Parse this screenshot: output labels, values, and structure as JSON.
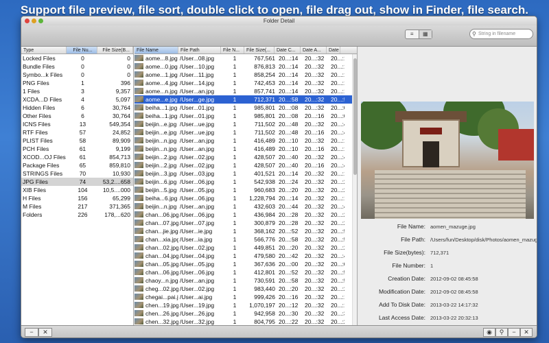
{
  "banner": "Support file preview, file sort, double click to open, file drag out, show in Finder, file search.",
  "window_title": "Folder Detail",
  "search": {
    "placeholder": "String in filename"
  },
  "icons": {
    "list": "list-icon",
    "grid": "grid-icon",
    "search": "magnifier-icon",
    "eye": "eye-icon"
  },
  "type_table": {
    "headers": [
      "Type",
      "File Nu...",
      "File Size(B..."
    ],
    "rows": [
      [
        "Locked Files",
        "0",
        "0"
      ],
      [
        "Bundle Files",
        "0",
        "0"
      ],
      [
        "Symbo...k Files",
        "0",
        "0"
      ],
      [
        "PNG Files",
        "1",
        "396"
      ],
      [
        "1 Files",
        "3",
        "9,357"
      ],
      [
        "XCDA...D Files",
        "4",
        "5,097"
      ],
      [
        "Hidden Files",
        "6",
        "30,764"
      ],
      [
        "Other Files",
        "6",
        "30,764"
      ],
      [
        "ICNS Files",
        "13",
        "549,354"
      ],
      [
        "RTF Files",
        "57",
        "24,852"
      ],
      [
        "PLIST Files",
        "58",
        "89,909"
      ],
      [
        "PCH Files",
        "61",
        "9,199"
      ],
      [
        "XCOD...OJ Files",
        "61",
        "854,713"
      ],
      [
        "Package Files",
        "65",
        "859,810"
      ],
      [
        "STRINGS Files",
        "70",
        "10,930"
      ],
      [
        "JPG Files",
        "74",
        "53,2....658"
      ],
      [
        "XIB Files",
        "104",
        "10,5....000"
      ],
      [
        "H Files",
        "156",
        "65,299"
      ],
      [
        "M Files",
        "217",
        "371,365"
      ],
      [
        "Folders",
        "226",
        "178,...620"
      ]
    ],
    "selected_index": 15
  },
  "files_table": {
    "headers": [
      "File Name",
      "File Path",
      "File N...",
      "File Size(...",
      "Date C...",
      "Date A...",
      "Date M"
    ],
    "rows": [
      [
        "aome...8.jpg",
        "/User...08.jpg",
        "1",
        "767,561",
        "20...:14",
        "20...:32",
        "20...:1"
      ],
      [
        "aome...0.jpg",
        "/User...10.jpg",
        "1",
        "876,813",
        "20...:14",
        "20...:32",
        "20...:1"
      ],
      [
        "aome...1.jpg",
        "/User...11.jpg",
        "1",
        "858,254",
        "20...:14",
        "20...:32",
        "20...:1"
      ],
      [
        "aome...4.jpg",
        "/User...14.jpg",
        "1",
        "742,453",
        "20...:14",
        "20...:32",
        "20...:1"
      ],
      [
        "aome...n.jpg",
        "/User...an.jpg",
        "1",
        "857,741",
        "20...:14",
        "20...:32",
        "20...:1"
      ],
      [
        "aome...e.jpg",
        "/User...ge.jpg",
        "1",
        "712,371",
        "20...:58",
        "20...:32",
        "20...:5"
      ],
      [
        "beiha...1.jpg",
        "/User...01.jpg",
        "1",
        "985,801",
        "20...:08",
        "20...:32",
        "20...:0"
      ],
      [
        "beiha...1.jpg",
        "/User...01.jpg",
        "1",
        "985,801",
        "20...:08",
        "20...:16",
        "20...:0"
      ],
      [
        "beijin...e.jpg",
        "/User...ue.jpg",
        "1",
        "711,502",
        "20...:48",
        "20...:32",
        "20...:4"
      ],
      [
        "beijin...e.jpg",
        "/User...ue.jpg",
        "1",
        "711,502",
        "20...:48",
        "20...:16",
        "20...:4"
      ],
      [
        "beijin...n.jpg",
        "/User...an.jpg",
        "1",
        "416,489",
        "20...:10",
        "20...:32",
        "20...:1"
      ],
      [
        "beijin...n.jpg",
        "/User...an.jpg",
        "1",
        "416,489",
        "20...:10",
        "20...:16",
        "20...:1"
      ],
      [
        "beijin...2.jpg",
        "/User...02.jpg",
        "1",
        "428,507",
        "20...:40",
        "20...:32",
        "20...:4"
      ],
      [
        "beijin...2.jpg",
        "/User...02.jpg",
        "1",
        "428,507",
        "20...:40",
        "20...:16",
        "20...:4"
      ],
      [
        "beijin...3.jpg",
        "/User...03.jpg",
        "1",
        "401,521",
        "20...:14",
        "20...:32",
        "20...:1"
      ],
      [
        "beijin...6.jpg",
        "/User...06.jpg",
        "1",
        "542,938",
        "20...:24",
        "20...:32",
        "20...:2"
      ],
      [
        "beijin...5.jpg",
        "/User...05.jpg",
        "1",
        "960,683",
        "20...:20",
        "20...:32",
        "20...:2"
      ],
      [
        "beiha...6.jpg",
        "/User...06.jpg",
        "1",
        "1,228,794",
        "20...:14",
        "20...:32",
        "20...:1"
      ],
      [
        "beijin...n.jpg",
        "/User...an.jpg",
        "1",
        "432,603",
        "20...:44",
        "20...:32",
        "20...:4"
      ],
      [
        "chan...06.jpg",
        "/User...06.jpg",
        "1",
        "436,984",
        "20...:28",
        "20...:32",
        "20...:2"
      ],
      [
        "chan...07.jpg",
        "/User...07.jpg",
        "1",
        "300,879",
        "20...:28",
        "20...:32",
        "20...:2"
      ],
      [
        "chan...jie.jpg",
        "/User...ie.jpg",
        "1",
        "368,162",
        "20...:52",
        "20...:32",
        "20...:5"
      ],
      [
        "chan...xia.jpg",
        "/User...ia.jpg",
        "1",
        "566,776",
        "20...:58",
        "20...:32",
        "20...:5"
      ],
      [
        "chan...02.jpg",
        "/User...02.jpg",
        "1",
        "449,851",
        "20...:20",
        "20...:32",
        "20...:2"
      ],
      [
        "chan...04.jpg",
        "/User...04.jpg",
        "1",
        "479,580",
        "20...:42",
        "20...:32",
        "20...:4"
      ],
      [
        "chan...05.jpg",
        "/User...05.jpg",
        "1",
        "367,636",
        "20...:00",
        "20...:32",
        "20...:0"
      ],
      [
        "chan...06.jpg",
        "/User...06.jpg",
        "1",
        "412,801",
        "20...:52",
        "20...:32",
        "20...:5"
      ],
      [
        "chaoy...n.jpg",
        "/User...an.jpg",
        "1",
        "730,591",
        "20...:58",
        "20...:32",
        "20...:5"
      ],
      [
        "cheg...02.jpg",
        "/User...02.jpg",
        "1",
        "983,440",
        "20...:20",
        "20...:32",
        "20...:2"
      ],
      [
        "chegai...pai.jpg",
        "/User...ai.jpg",
        "1",
        "999,426",
        "20...:16",
        "20...:32",
        "20...:1"
      ],
      [
        "chen...19.jpg",
        "/User...19.jpg",
        "1",
        "1,070,197",
        "20...:12",
        "20...:32",
        "20...:1"
      ],
      [
        "chen...26.jpg",
        "/User...26.jpg",
        "1",
        "942,958",
        "20...:30",
        "20...:32",
        "20...:3"
      ],
      [
        "chen...32.jpg",
        "/User...32.jpg",
        "1",
        "804,795",
        "20...:22",
        "20...:32",
        "20...:2"
      ]
    ],
    "selected_index": 5
  },
  "detail": {
    "labels": [
      "File Name:",
      "File Path:",
      "File Size(bytes):",
      "File Number:",
      "Creation Date:",
      "Modification Date:",
      "Add To Disk Date:",
      "Last Access Date:"
    ],
    "values": [
      "aomen_mazuge.jpg",
      "/Users/fun/Desktop/disk/Photos/aomen_mazuge.jpg",
      "712,371",
      "1",
      "2012-09-02  08:45:58",
      "2012-09-02  08:45:58",
      "2013-03-22  14:17:32",
      "2013-03-22  20:32:13"
    ]
  },
  "bottom_left": {
    "minus": "−",
    "close": "✕"
  },
  "bottom_right": {
    "eye": "◉",
    "search": "⚲",
    "minus": "−",
    "close": "✕"
  },
  "toolbar": {
    "list_glyph": "≡",
    "grid_glyph": "▦",
    "search_glyph": "⚲"
  }
}
